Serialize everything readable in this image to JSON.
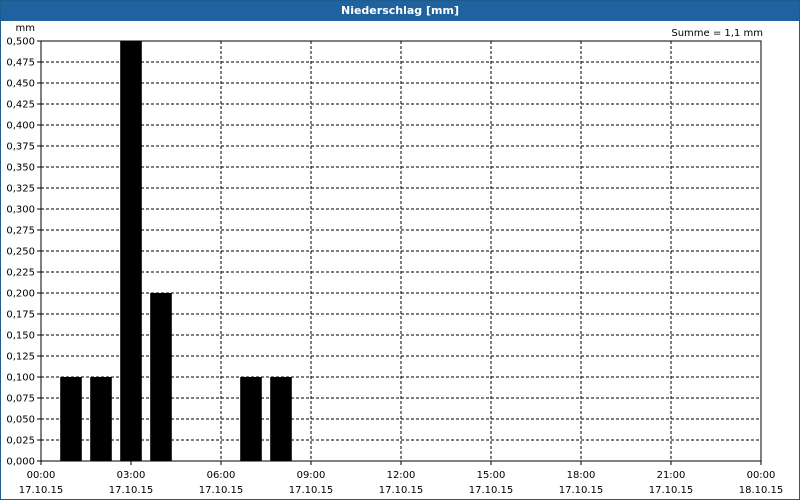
{
  "window": {
    "title": "Niederschlag [mm]"
  },
  "summary": {
    "label": "Summe = 1,1 mm"
  },
  "colors": {
    "titlebar": "#1f62a0",
    "bar": "#000000",
    "grid": "#000000"
  },
  "chart_data": {
    "type": "bar",
    "title": "Niederschlag [mm]",
    "ylabel": "mm",
    "ylim": [
      0,
      0.5
    ],
    "yticks": [
      "0,000",
      "0,025",
      "0,050",
      "0,075",
      "0,100",
      "0,125",
      "0,150",
      "0,175",
      "0,200",
      "0,225",
      "0,250",
      "0,275",
      "0,300",
      "0,325",
      "0,350",
      "0,375",
      "0,400",
      "0,425",
      "0,450",
      "0,475",
      "0,500"
    ],
    "xlim_hours": [
      0,
      24
    ],
    "xticks": [
      {
        "time": "00:00",
        "date": "17.10.15"
      },
      {
        "time": "03:00",
        "date": "17.10.15"
      },
      {
        "time": "06:00",
        "date": "17.10.15"
      },
      {
        "time": "09:00",
        "date": "17.10.15"
      },
      {
        "time": "12:00",
        "date": "17.10.15"
      },
      {
        "time": "15:00",
        "date": "17.10.15"
      },
      {
        "time": "18:00",
        "date": "17.10.15"
      },
      {
        "time": "21:00",
        "date": "17.10.15"
      },
      {
        "time": "00:00",
        "date": "18.10.15"
      }
    ],
    "bars": [
      {
        "hour": 1,
        "value": 0.1
      },
      {
        "hour": 2,
        "value": 0.1
      },
      {
        "hour": 3,
        "value": 0.5
      },
      {
        "hour": 4,
        "value": 0.2
      },
      {
        "hour": 7,
        "value": 0.1
      },
      {
        "hour": 8,
        "value": 0.1
      }
    ],
    "grid": true
  }
}
